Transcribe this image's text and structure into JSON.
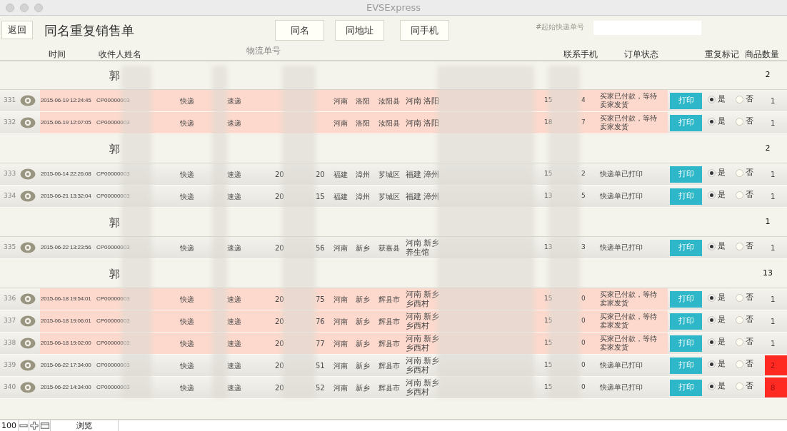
{
  "window": {
    "title": "EVSExpress"
  },
  "toolbar": {
    "back_button": "返回",
    "title": "同名重复销售单",
    "filters": [
      {
        "label": "同名"
      },
      {
        "label": "同地址"
      },
      {
        "label": "同手机"
      }
    ],
    "tracking_start_label": "#起始快递单号"
  },
  "columns": [
    "时间",
    "收件人姓名",
    "物流单号",
    "联系手机",
    "订单状态",
    "重复标记",
    "商品数量"
  ],
  "groups": [
    {
      "name": "郭",
      "count": "2",
      "rows": [
        {
          "num": "331",
          "time": "2015-06-19 12:24:45",
          "code": "CP00000003",
          "carrier": "快递",
          "company": "速递",
          "province": "河南",
          "city": "洛阳",
          "county": "汝阳县",
          "address": [
            "河南 洛阳"
          ],
          "phone_start": "15",
          "phone_end": "4",
          "status": "买家已付款，等待卖家发货",
          "highlighted": true,
          "print": "打印",
          "marks": [
            {
              "label": "是",
              "selected": true
            },
            {
              "label": "否",
              "selected": false
            }
          ],
          "quantity": "1",
          "alert": false
        },
        {
          "num": "332",
          "time": "2015-06-19 12:07:05",
          "code": "CP00000003",
          "carrier": "快递",
          "company": "速递",
          "province": "河南",
          "city": "洛阳",
          "county": "汝阳县",
          "address": [
            "河南 洛阳"
          ],
          "phone_start": "18",
          "phone_end": "7",
          "status": "买家已付款，等待卖家发货",
          "highlighted": true,
          "print": "打印",
          "marks": [
            {
              "label": "是",
              "selected": true
            },
            {
              "label": "否",
              "selected": false
            }
          ],
          "quantity": "1",
          "alert": false
        }
      ]
    },
    {
      "name": "郭",
      "count": "2",
      "rows": [
        {
          "num": "333",
          "time": "2015-06-14 22:26:08",
          "code": "CP00000003",
          "carrier": "快递",
          "company": "速递",
          "tracking_start": "20",
          "tracking_end": "20",
          "province": "福建",
          "city": "漳州",
          "county": "芗城区",
          "address": [
            "福建 漳州"
          ],
          "phone_start": "15",
          "phone_end": "2",
          "status": "快递单已打印",
          "highlighted": false,
          "print": "打印",
          "marks": [
            {
              "label": "是",
              "selected": true
            },
            {
              "label": "否",
              "selected": false
            }
          ],
          "quantity": "1",
          "alert": false
        },
        {
          "num": "334",
          "time": "2015-06-21 13:32:04",
          "code": "CP00000003",
          "carrier": "快递",
          "company": "速递",
          "tracking_start": "20",
          "tracking_end": "15",
          "province": "福建",
          "city": "漳州",
          "county": "芗城区",
          "address": [
            "福建 漳州"
          ],
          "phone_start": "13",
          "phone_end": "5",
          "status": "快递单已打印",
          "highlighted": false,
          "print": "打印",
          "marks": [
            {
              "label": "是",
              "selected": true
            },
            {
              "label": "否",
              "selected": false
            }
          ],
          "quantity": "1",
          "alert": false
        }
      ]
    },
    {
      "name": "郭",
      "count": "1",
      "rows": [
        {
          "num": "335",
          "time": "2015-06-22 13:23:56",
          "code": "CP00000003",
          "carrier": "快递",
          "company": "速递",
          "tracking_start": "20",
          "tracking_end": "56",
          "province": "河南",
          "city": "新乡",
          "county": "获嘉县",
          "address": [
            "河南 新乡",
            "养生馆"
          ],
          "phone_start": "13",
          "phone_end": "3",
          "status": "快递单已打印",
          "highlighted": false,
          "print": "打印",
          "marks": [
            {
              "label": "是",
              "selected": true
            },
            {
              "label": "否",
              "selected": false
            }
          ],
          "quantity": "1",
          "alert": false
        }
      ]
    },
    {
      "name": "郭",
      "count": "13",
      "rows": [
        {
          "num": "336",
          "time": "2015-06-18 19:54:01",
          "code": "CP00000003",
          "carrier": "快递",
          "company": "速递",
          "tracking_start": "20",
          "tracking_end": "75",
          "province": "河南",
          "city": "新乡",
          "county": "辉县市",
          "address": [
            "河南 新乡",
            "乡西村"
          ],
          "phone_start": "15",
          "phone_end": "0",
          "status": "买家已付款，等待卖家发货",
          "highlighted": true,
          "print": "打印",
          "marks": [
            {
              "label": "是",
              "selected": true
            },
            {
              "label": "否",
              "selected": false
            }
          ],
          "quantity": "1",
          "alert": false
        },
        {
          "num": "337",
          "time": "2015-06-18 19:06:01",
          "code": "CP00000003",
          "carrier": "快递",
          "company": "速递",
          "tracking_start": "20",
          "tracking_end": "76",
          "province": "河南",
          "city": "新乡",
          "county": "辉县市",
          "address": [
            "河南 新乡",
            "乡西村"
          ],
          "phone_start": "15",
          "phone_end": "0",
          "status": "买家已付款，等待卖家发货",
          "highlighted": true,
          "print": "打印",
          "marks": [
            {
              "label": "是",
              "selected": true
            },
            {
              "label": "否",
              "selected": false
            }
          ],
          "quantity": "1",
          "alert": false
        },
        {
          "num": "338",
          "time": "2015-06-18 19:02:00",
          "code": "CP00000003",
          "carrier": "快递",
          "company": "速递",
          "tracking_start": "20",
          "tracking_end": "77",
          "province": "河南",
          "city": "新乡",
          "county": "辉县市",
          "address": [
            "河南 新乡",
            "乡西村"
          ],
          "phone_start": "15",
          "phone_end": "0",
          "status": "买家已付款，等待卖家发货",
          "highlighted": true,
          "print": "打印",
          "marks": [
            {
              "label": "是",
              "selected": true
            },
            {
              "label": "否",
              "selected": false
            }
          ],
          "quantity": "1",
          "alert": false
        },
        {
          "num": "339",
          "time": "2015-06-22 17:34:00",
          "code": "CP00000003",
          "carrier": "快递",
          "company": "速递",
          "tracking_start": "20",
          "tracking_end": "51",
          "province": "河南",
          "city": "新乡",
          "county": "辉县市",
          "address": [
            "河南 新乡",
            "乡西村"
          ],
          "phone_start": "15",
          "phone_end": "0",
          "status": "快递单已打印",
          "highlighted": false,
          "print": "打印",
          "marks": [
            {
              "label": "是",
              "selected": true
            },
            {
              "label": "否",
              "selected": false
            }
          ],
          "quantity": "2",
          "alert": true
        },
        {
          "num": "340",
          "time": "2015-06-22 14:34:00",
          "code": "CP00000003",
          "carrier": "快递",
          "company": "速递",
          "tracking_start": "20",
          "tracking_end": "52",
          "province": "河南",
          "city": "新乡",
          "county": "辉县市",
          "address": [
            "河南 新乡",
            "乡西村"
          ],
          "phone_start": "15",
          "phone_end": "0",
          "status": "快递单已打印",
          "highlighted": false,
          "print": "打印",
          "marks": [
            {
              "label": "是",
              "selected": true
            },
            {
              "label": "否",
              "selected": false
            }
          ],
          "quantity": "8",
          "alert": true
        }
      ]
    }
  ],
  "status_bar": {
    "zoom": "100",
    "mode": "浏览"
  }
}
